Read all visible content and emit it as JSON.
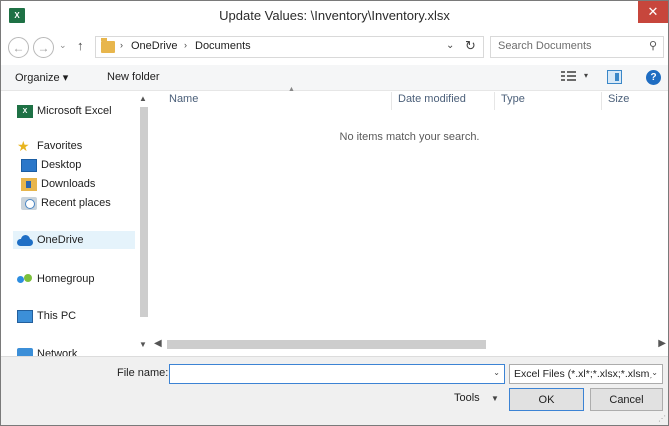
{
  "window": {
    "app_icon_text": "X",
    "title": "Update Values: \\Inventory\\Inventory.xlsx",
    "close_glyph": "✕"
  },
  "navigation": {
    "back_glyph": "←",
    "forward_glyph": "→",
    "recent_glyph": "⌄",
    "up_glyph": "↑",
    "refresh_glyph": "↻",
    "dropdown_glyph": "⌄",
    "separator_glyph": "›",
    "breadcrumbs": [
      "OneDrive",
      "Documents"
    ]
  },
  "search": {
    "placeholder": "Search Documents",
    "icon": "search-icon",
    "glyph": "⚲"
  },
  "toolbar": {
    "organize_label": "Organize ▾",
    "new_folder_label": "New folder",
    "view_caret": "▾",
    "help_glyph": "?"
  },
  "navpane": {
    "items": [
      {
        "label": "Microsoft Excel",
        "icon": "excel-icon",
        "icon_text": "X"
      },
      {
        "label": "Favorites",
        "icon": "star-icon",
        "icon_text": "★"
      },
      {
        "label": "Desktop",
        "icon": "desktop-icon"
      },
      {
        "label": "Downloads",
        "icon": "downloads-icon"
      },
      {
        "label": "Recent places",
        "icon": "recent-places-icon"
      },
      {
        "label": "OneDrive",
        "icon": "onedrive-icon",
        "selected": true
      },
      {
        "label": "Homegroup",
        "icon": "homegroup-icon"
      },
      {
        "label": "This PC",
        "icon": "this-pc-icon"
      },
      {
        "label": "Network",
        "icon": "network-icon"
      }
    ]
  },
  "scrollbar": {
    "up_glyph": "▲",
    "down_glyph": "▼",
    "left_glyph": "◀",
    "right_glyph": "▶"
  },
  "filelist": {
    "columns": [
      "Name",
      "Date modified",
      "Type",
      "Size"
    ],
    "sort_glyph": "▲",
    "empty_message": "No items match your search."
  },
  "footer": {
    "filename_label": "File name:",
    "filename_value": "",
    "combo_caret": "⌄",
    "filter_value": "Excel Files (*.xl*;*.xlsx;*.xlsm;",
    "tools_label": "Tools",
    "tools_caret": "▼",
    "ok_label": "OK",
    "cancel_label": "Cancel",
    "grip_glyph": "⋰"
  },
  "colors": {
    "close_button": "#c7463c",
    "excel_green": "#1e7145",
    "selection": "#e5f3fb",
    "focus_border": "#3c83d4"
  }
}
